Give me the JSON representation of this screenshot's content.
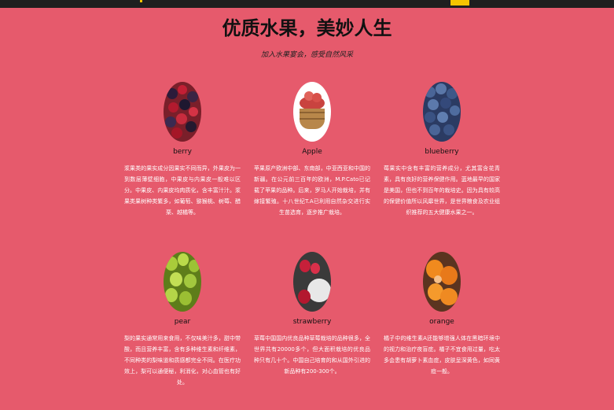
{
  "header": {
    "title": "优质水果，美妙人生",
    "subtitle": "加入水果宴会，感受自然风采"
  },
  "fruits": [
    {
      "name": "berry",
      "icon": "berry-image",
      "description": "浆果类的果实成分因果实不同而异，外果皮为一到数层薄壁细胞，中果皮与内果皮一般难以区分。中果皮、内果皮均肉质化，含丰富汁汁。浆果类果树种类繁多，如葡萄、猕猴桃、树莓、醋栗、越橘等。"
    },
    {
      "name": "Apple",
      "icon": "apple-image",
      "description": "苹果原产欧洲中部、东南部，中亚西亚和中国的新疆。在公元前三百年的欧洲，M.P.Cato已记载了苹果的品种。后来，罗马人开始栽培，并有嫁接繁殖。十八世纪T.A已利用自然杂交进行实生苗选育，逐步推广栽培。"
    },
    {
      "name": "blueberry",
      "icon": "blueberry-image",
      "description": "莓果实中含有丰富的营养成分，尤其富含花青素，具有良好的营养保健作用。蓝地最早的国家是美国，但也不到百年的栽培史。因为具有较高的保健价值所以风靡世界，是世界粮食及农业组织推荐的五大健康水果之一。"
    },
    {
      "name": "pear",
      "icon": "pear-image",
      "description": "梨的果实通常用来食用，不仅味美汁多，甜中带酸，而且营养丰富，含有多种维生素和纤维素，不同种类的梨味道和质感都完全不同。在医疗功效上，梨可以通便秘，利消化，对心血管也有好处。"
    },
    {
      "name": "strawberry",
      "icon": "strawberry-image",
      "description": "草莓中国国内优良品种草莓栽培的品种很多，全世界共有20000多个，但大面积栽培的优良品种只有几十个。中国自己培育的和从国外引进的新品种有200-300个。"
    },
    {
      "name": "orange",
      "icon": "orange-image",
      "description": "橘子中的维生素A还能够增强人体在黑暗环境中的视力和治疗夜盲症。橘子不宜食用过量，吃太多会患有胡萝卜素血症，皮肤呈深黄色，如同黄疸一般。"
    }
  ],
  "colors": {
    "background": "#e65a6c",
    "topbar": "#1f1f1f",
    "accent": "#f5c400"
  }
}
